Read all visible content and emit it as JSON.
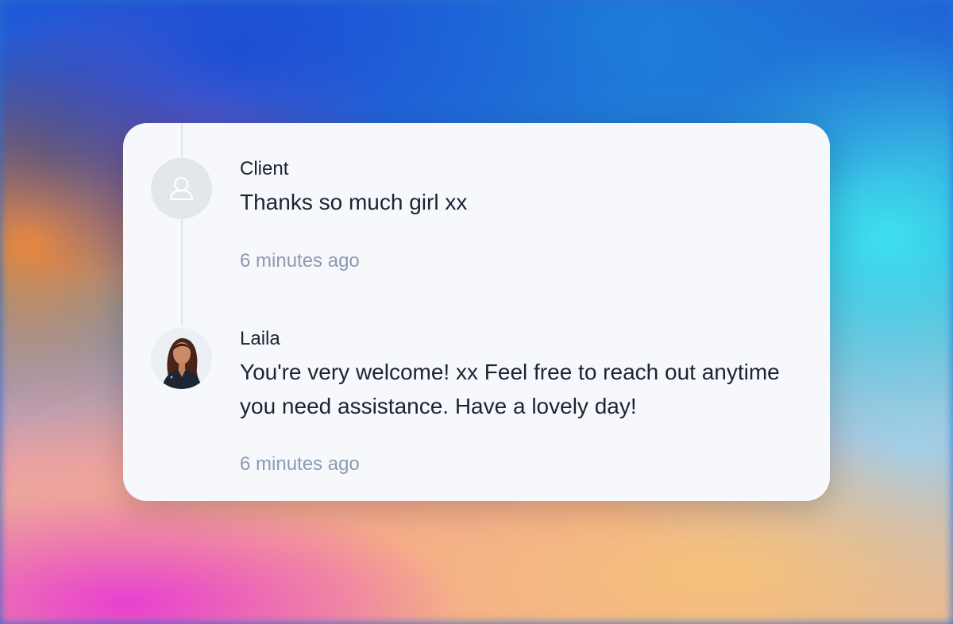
{
  "messages": [
    {
      "author": "Client",
      "text": "Thanks so much girl xx",
      "time": "6 minutes ago",
      "avatar_icon": "user-outline-icon"
    },
    {
      "author": "Laila",
      "text": "You're very welcome! xx Feel free to reach out anytime you need assistance. Have a lovely day!",
      "time": "6 minutes ago",
      "avatar_icon": "profile-photo"
    }
  ],
  "colors": {
    "card_background": "#f7f8fb",
    "text_primary": "#1b2433",
    "text_muted": "#8a9bb2",
    "timeline": "#e2e5ea",
    "avatar_placeholder": "#e3e7ec"
  }
}
